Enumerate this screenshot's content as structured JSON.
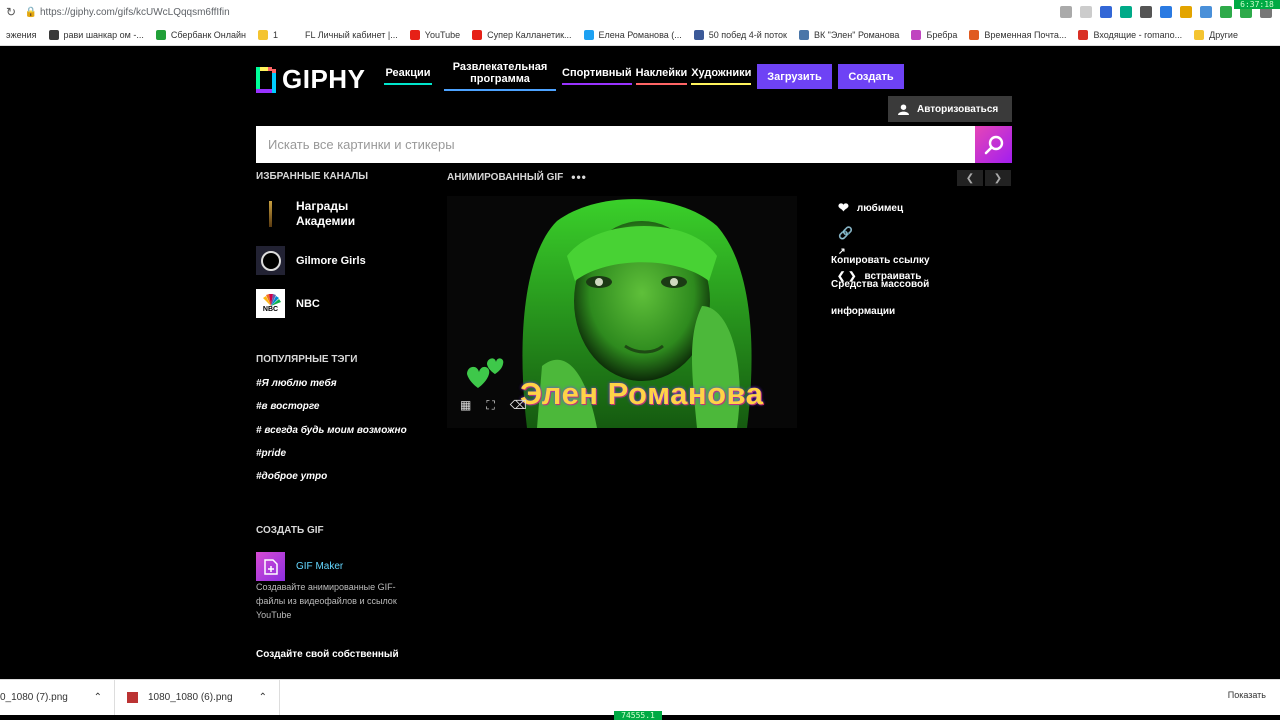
{
  "browser": {
    "url": "https://giphy.com/gifs/kcUWcLQqqsm6ffIfin",
    "clock_top": "6:37:18",
    "clock_bottom": "74555.1",
    "bookmarks": [
      {
        "label": "эжения",
        "color": "#ffffff"
      },
      {
        "label": "рави шанкар ом -...",
        "color": "#3a3a3a"
      },
      {
        "label": "Сбербанк Онлайн",
        "color": "#21a038"
      },
      {
        "label": "1",
        "color": "#f4c430"
      },
      {
        "label": "FL  Личный кабинет |...",
        "color": "#ffffff"
      },
      {
        "label": "YouTube",
        "color": "#e62117"
      },
      {
        "label": "Супер Калланетик...",
        "color": "#e62117"
      },
      {
        "label": "Елена Романова (...",
        "color": "#1da1f2"
      },
      {
        "label": "50 побед 4-й поток",
        "color": "#3b5998"
      },
      {
        "label": "ВК \"Элен\" Романова",
        "color": "#4a76a8"
      },
      {
        "label": "Бребра",
        "color": "#c044c0"
      },
      {
        "label": "Временная Почта...",
        "color": "#e05a20"
      },
      {
        "label": "Входящие - romano...",
        "color": "#d93025"
      },
      {
        "label": "Другие",
        "color": "#f4c430"
      }
    ],
    "downloads": [
      {
        "name": "0_1080 (7).png"
      },
      {
        "name": "1080_1080 (6).png"
      }
    ],
    "show_all": "Показать"
  },
  "header": {
    "logo": "GIPHY",
    "nav": [
      {
        "label": "Реакции",
        "underline": "#00e6cc"
      },
      {
        "label": "Развлекательная программа",
        "underline": "#4da3ff"
      },
      {
        "label": "Спортивный",
        "underline": "#9933ff"
      },
      {
        "label": "Наклейки",
        "underline": "#ff6666"
      },
      {
        "label": "Художники",
        "underline": "#fff35c"
      }
    ],
    "upload_label": "Загрузить",
    "create_label": "Создать",
    "login_label": "Авторизоваться"
  },
  "search": {
    "placeholder": "Искать все картинки и стикеры"
  },
  "sidebar": {
    "featured_title": "ИЗБРАННЫЕ КАНАЛЫ",
    "channels": [
      {
        "name": "Награды Академии"
      },
      {
        "name": "Gilmore Girls"
      },
      {
        "name": "NBC"
      }
    ],
    "popular_title": "ПОПУЛЯРНЫЕ ТЭГИ",
    "tags": [
      "#Я люблю тебя",
      "#в восторге",
      "# всегда будь моим возможно",
      "#pride",
      "#доброе утро"
    ],
    "create_title": "СОЗДАТЬ GIF",
    "maker_title": "GIF Maker",
    "maker_desc": "Создавайте анимированные GIF-файлы из видеофайлов и ссылок YouTube",
    "own_label": "Создайте свой собственный"
  },
  "gif": {
    "section_label": "АНИМИРОВАННЫЙ GIF",
    "caption": "Элен Романова"
  },
  "actions": {
    "favorite": "любимец",
    "copy_link": "Копировать ссылку",
    "embed": "встраивать",
    "media": "Средства массовой",
    "info": "информации"
  },
  "colors": {
    "brand_purple": "#6e42f5",
    "search_gradient_start": "#e646b6",
    "search_gradient_end": "#a21ef0"
  }
}
